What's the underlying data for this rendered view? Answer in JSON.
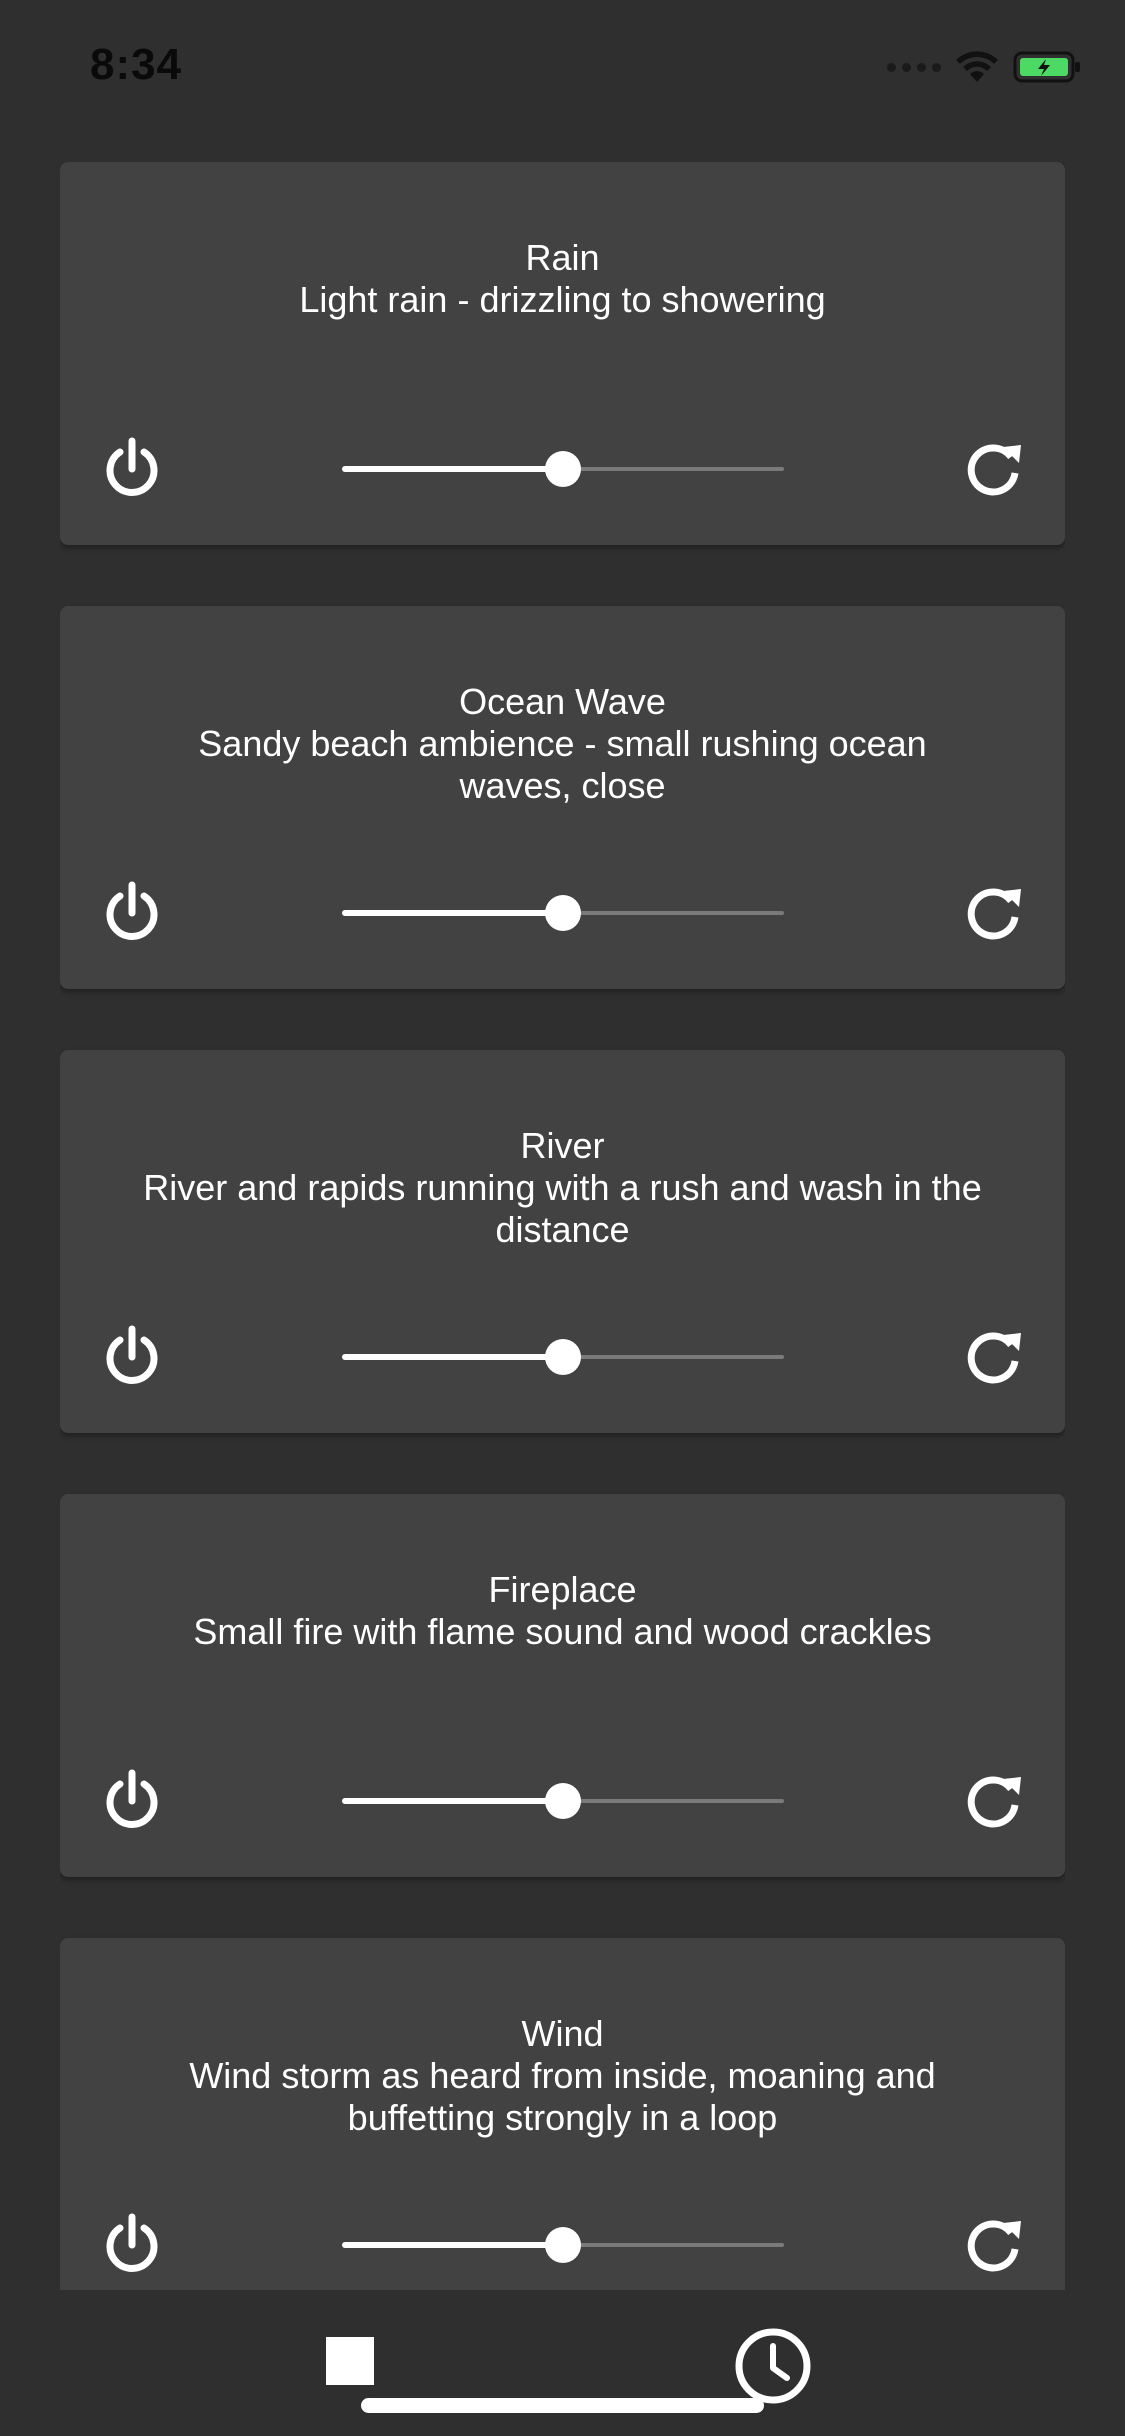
{
  "status_bar": {
    "time": "8:34",
    "icons": [
      "signal-dots-icon",
      "wifi-icon",
      "battery-charging-icon"
    ],
    "battery_color": "#4cd964"
  },
  "sounds": [
    {
      "title": "Rain",
      "description": "Light rain - drizzling to showering",
      "volume": 0.5,
      "power_icon": "power-icon",
      "refresh_icon": "refresh-icon"
    },
    {
      "title": "Ocean Wave",
      "description": "Sandy beach ambience - small rushing ocean waves, close",
      "volume": 0.5,
      "power_icon": "power-icon",
      "refresh_icon": "refresh-icon"
    },
    {
      "title": "River",
      "description": "River and rapids running with a rush and wash in the distance",
      "volume": 0.5,
      "power_icon": "power-icon",
      "refresh_icon": "refresh-icon"
    },
    {
      "title": "Fireplace",
      "description": "Small fire with flame sound and wood crackles",
      "volume": 0.5,
      "power_icon": "power-icon",
      "refresh_icon": "refresh-icon"
    },
    {
      "title": "Wind",
      "description": "Wind storm as heard from inside, moaning and buffetting strongly in a loop",
      "volume": 0.5,
      "power_icon": "power-icon",
      "refresh_icon": "refresh-icon"
    }
  ],
  "bottom_bar": {
    "stop_icon": "stop-icon",
    "timer_icon": "clock-icon"
  },
  "colors": {
    "background": "#2f2f2f",
    "card": "#424242",
    "slider_active": "#ffffff",
    "slider_inactive": "#7a7a7a",
    "text": "#ffffff"
  }
}
